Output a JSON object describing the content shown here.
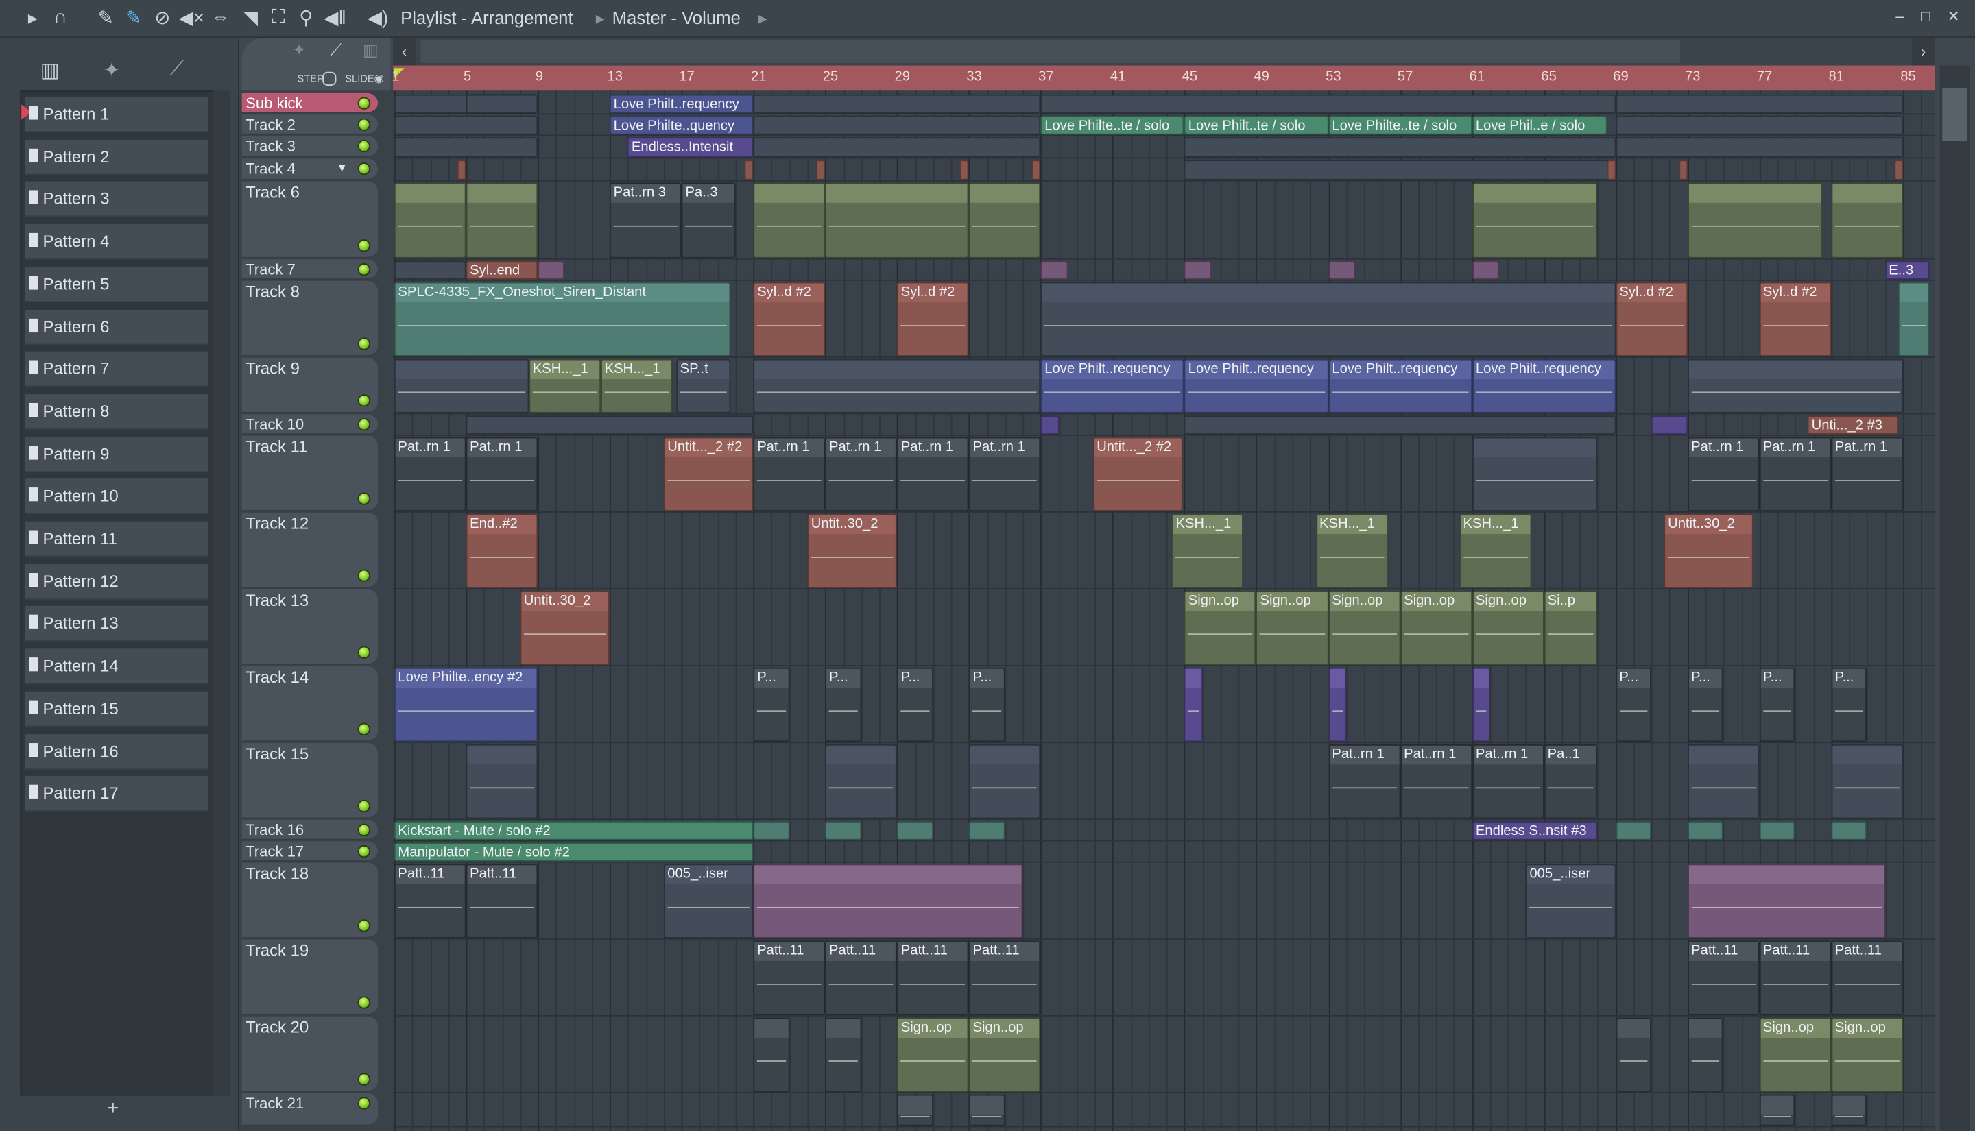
{
  "toolbar": {
    "breadcrumb": [
      "Playlist - Arrangement",
      "Master - Volume"
    ],
    "icons": [
      "play-arrow-icon",
      "magnet-icon",
      "pencil-icon",
      "paint-icon",
      "delete-icon",
      "mute-icon",
      "slip-icon",
      "select-icon",
      "zoom-select-icon",
      "zoom-icon",
      "playback-icon",
      "speaker-icon"
    ]
  },
  "picker": {
    "tabs": [
      "piano-roll-icon",
      "audio-icon",
      "automation-icon"
    ],
    "patterns": [
      "Pattern 1",
      "Pattern 2",
      "Pattern 3",
      "Pattern 4",
      "Pattern 5",
      "Pattern 6",
      "Pattern 7",
      "Pattern 8",
      "Pattern 9",
      "Pattern 10",
      "Pattern 11",
      "Pattern 12",
      "Pattern 13",
      "Pattern 14",
      "Pattern 15",
      "Pattern 16",
      "Pattern 17"
    ],
    "add": "+"
  },
  "snap": {
    "step": "STEP",
    "slide": "SLIDE"
  },
  "ruler": [
    "1",
    "5",
    "9",
    "13",
    "17",
    "21",
    "25",
    "29",
    "33",
    "37",
    "41",
    "45",
    "49",
    "53",
    "57",
    "61",
    "65",
    "69",
    "73",
    "77",
    "81",
    "85"
  ],
  "colors": {
    "accent": "#b85a72",
    "ruler": "#a2585c",
    "led": "#7bc523"
  },
  "tracks": [
    {
      "name": "Sub kick",
      "clips": [
        {
          "s": 1,
          "l": 8,
          "c": "dark"
        },
        {
          "s": 5,
          "l": 4,
          "c": "dark"
        },
        {
          "s": 13,
          "l": 8,
          "c": "auto",
          "t": "Love Philt..requency"
        },
        {
          "s": 21,
          "l": 16,
          "c": "dark"
        },
        {
          "s": 37,
          "l": 32,
          "c": "dark"
        },
        {
          "s": 69,
          "l": 16,
          "c": "dark"
        }
      ]
    },
    {
      "name": "Track 2",
      "clips": [
        {
          "s": 1,
          "l": 8,
          "c": "dark"
        },
        {
          "s": 13,
          "l": 8,
          "c": "auto",
          "t": "Love Philte..quency"
        },
        {
          "s": 21,
          "l": 16,
          "c": "dark"
        },
        {
          "s": 37,
          "l": 8,
          "c": "green",
          "t": "Love Philte..te / solo"
        },
        {
          "s": 45,
          "l": 8,
          "c": "green",
          "t": "Love Philt..te / solo"
        },
        {
          "s": 53,
          "l": 8,
          "c": "green",
          "t": "Love Philte..te / solo"
        },
        {
          "s": 61,
          "l": 7.5,
          "c": "green",
          "t": "Love Phil..e / solo"
        },
        {
          "s": 69,
          "l": 16,
          "c": "dark"
        }
      ]
    },
    {
      "name": "Track 3",
      "clips": [
        {
          "s": 1,
          "l": 8,
          "c": "dark"
        },
        {
          "s": 14,
          "l": 7,
          "c": "auto2",
          "t": "Endless..Intensit"
        },
        {
          "s": 21,
          "l": 16,
          "c": "dark"
        },
        {
          "s": 45,
          "l": 24,
          "c": "dark"
        },
        {
          "s": 69,
          "l": 16,
          "c": "dark"
        }
      ]
    },
    {
      "name": "Track 4",
      "clips": [
        {
          "s": 4.5,
          "l": 0.5,
          "c": "brown"
        },
        {
          "s": 20.5,
          "l": 0.5,
          "c": "brown"
        },
        {
          "s": 24.5,
          "l": 0.5,
          "c": "brown"
        },
        {
          "s": 32.5,
          "l": 0.5,
          "c": "brown"
        },
        {
          "s": 36.5,
          "l": 0.5,
          "c": "brown"
        },
        {
          "s": 45,
          "l": 24,
          "c": "dark"
        },
        {
          "s": 68.5,
          "l": 0.5,
          "c": "brown"
        },
        {
          "s": 72.5,
          "l": 0.5,
          "c": "brown"
        },
        {
          "s": 84.5,
          "l": 0.5,
          "c": "brown"
        }
      ]
    },
    {
      "name": "Track 6",
      "clips": [
        {
          "s": 1,
          "l": 4,
          "c": "olive"
        },
        {
          "s": 5,
          "l": 4,
          "c": "olive"
        },
        {
          "s": 13,
          "l": 4,
          "c": "pat",
          "t": "Pat..rn 3"
        },
        {
          "s": 17,
          "l": 3,
          "c": "pat",
          "t": "Pa..3"
        },
        {
          "s": 21,
          "l": 4,
          "c": "olive"
        },
        {
          "s": 25,
          "l": 8,
          "c": "olive"
        },
        {
          "s": 33,
          "l": 4,
          "c": "olive"
        },
        {
          "s": 61,
          "l": 7,
          "c": "olive"
        },
        {
          "s": 73,
          "l": 7.5,
          "c": "olive"
        },
        {
          "s": 81,
          "l": 4,
          "c": "olive"
        }
      ]
    },
    {
      "name": "Track 7",
      "clips": [
        {
          "s": 1,
          "l": 4,
          "c": "dark"
        },
        {
          "s": 5,
          "l": 4,
          "c": "brown",
          "t": "Syl..end"
        },
        {
          "s": 9,
          "l": 1.5,
          "c": "pink"
        },
        {
          "s": 37,
          "l": 1.5,
          "c": "pink"
        },
        {
          "s": 45,
          "l": 1.5,
          "c": "pink"
        },
        {
          "s": 53,
          "l": 1.5,
          "c": "pink"
        },
        {
          "s": 61,
          "l": 1.5,
          "c": "pink"
        },
        {
          "s": 84,
          "l": 2.5,
          "c": "auto2",
          "t": "E..3"
        }
      ]
    },
    {
      "name": "Track 8",
      "clips": [
        {
          "s": 1,
          "l": 18.7,
          "c": "teal",
          "t": "SPLC-4335_FX_Oneshot_Siren_Distant"
        },
        {
          "s": 21,
          "l": 4,
          "c": "brown",
          "t": "Syl..d #2"
        },
        {
          "s": 29,
          "l": 4,
          "c": "brown",
          "t": "Syl..d #2"
        },
        {
          "s": 37,
          "l": 32,
          "c": "dark"
        },
        {
          "s": 69,
          "l": 4,
          "c": "brown",
          "t": "Syl..d #2"
        },
        {
          "s": 77,
          "l": 4,
          "c": "brown",
          "t": "Syl..d #2"
        },
        {
          "s": 84.7,
          "l": 1.8,
          "c": "teal"
        }
      ]
    },
    {
      "name": "Track 9",
      "clips": [
        {
          "s": 1,
          "l": 7.5,
          "c": "dark"
        },
        {
          "s": 8.5,
          "l": 4,
          "c": "olive",
          "t": "KSH..._1"
        },
        {
          "s": 12.5,
          "l": 4,
          "c": "olive",
          "t": "KSH..._1"
        },
        {
          "s": 16.7,
          "l": 3,
          "c": "dark",
          "t": "SP..t"
        },
        {
          "s": 21,
          "l": 16,
          "c": "dark"
        },
        {
          "s": 37,
          "l": 8,
          "c": "auto",
          "t": "Love Philt..requency"
        },
        {
          "s": 45,
          "l": 8,
          "c": "auto",
          "t": "Love Philt..requency"
        },
        {
          "s": 53,
          "l": 8,
          "c": "auto",
          "t": "Love Philt..requency"
        },
        {
          "s": 61,
          "l": 8,
          "c": "auto",
          "t": "Love Philt..requency"
        },
        {
          "s": 73,
          "l": 12,
          "c": "dark"
        }
      ]
    },
    {
      "name": "Track 10",
      "clips": [
        {
          "s": 5,
          "l": 16,
          "c": "dark"
        },
        {
          "s": 37,
          "l": 1,
          "c": "auto2"
        },
        {
          "s": 45,
          "l": 24,
          "c": "dark"
        },
        {
          "s": 71,
          "l": 2,
          "c": "auto2"
        },
        {
          "s": 79.7,
          "l": 5,
          "c": "brown",
          "t": "Unti..._2 #3"
        }
      ]
    },
    {
      "name": "Track 11",
      "clips": [
        {
          "s": 1,
          "l": 4,
          "c": "pat",
          "t": "Pat..rn 1"
        },
        {
          "s": 5,
          "l": 4,
          "c": "pat",
          "t": "Pat..rn 1"
        },
        {
          "s": 16,
          "l": 5,
          "c": "brown",
          "t": "Untit..._2 #2"
        },
        {
          "s": 21,
          "l": 4,
          "c": "pat",
          "t": "Pat..rn 1"
        },
        {
          "s": 25,
          "l": 4,
          "c": "pat",
          "t": "Pat..rn 1"
        },
        {
          "s": 29,
          "l": 4,
          "c": "pat",
          "t": "Pat..rn 1"
        },
        {
          "s": 33,
          "l": 4,
          "c": "pat",
          "t": "Pat..rn 1"
        },
        {
          "s": 39.9,
          "l": 5,
          "c": "brown",
          "t": "Untit..._2 #2"
        },
        {
          "s": 61,
          "l": 7,
          "c": "dark"
        },
        {
          "s": 73,
          "l": 4,
          "c": "pat",
          "t": "Pat..rn 1"
        },
        {
          "s": 77,
          "l": 4,
          "c": "pat",
          "t": "Pat..rn 1"
        },
        {
          "s": 81,
          "l": 4,
          "c": "pat",
          "t": "Pat..rn 1"
        }
      ]
    },
    {
      "name": "Track 12",
      "clips": [
        {
          "s": 5,
          "l": 4,
          "c": "brown",
          "t": "End..#2"
        },
        {
          "s": 24,
          "l": 5,
          "c": "brown",
          "t": "Untit..30_2"
        },
        {
          "s": 44.3,
          "l": 4,
          "c": "olive",
          "t": "KSH..._1"
        },
        {
          "s": 52.3,
          "l": 4,
          "c": "olive",
          "t": "KSH..._1"
        },
        {
          "s": 60.3,
          "l": 4,
          "c": "olive",
          "t": "KSH..._1"
        },
        {
          "s": 71.7,
          "l": 5,
          "c": "brown",
          "t": "Untit..30_2"
        }
      ]
    },
    {
      "name": "Track 13",
      "clips": [
        {
          "s": 8,
          "l": 5,
          "c": "brown",
          "t": "Untit..30_2"
        },
        {
          "s": 45,
          "l": 4,
          "c": "olive",
          "t": "Sign..op"
        },
        {
          "s": 49,
          "l": 4,
          "c": "olive",
          "t": "Sign..op"
        },
        {
          "s": 53,
          "l": 4,
          "c": "olive",
          "t": "Sign..op"
        },
        {
          "s": 57,
          "l": 4,
          "c": "olive",
          "t": "Sign..op"
        },
        {
          "s": 61,
          "l": 4,
          "c": "olive",
          "t": "Sign..op"
        },
        {
          "s": 65,
          "l": 3,
          "c": "olive",
          "t": "Si..p"
        }
      ]
    },
    {
      "name": "Track 14",
      "clips": [
        {
          "s": 1,
          "l": 8,
          "c": "auto",
          "t": "Love Philte..ency #2"
        },
        {
          "s": 21,
          "l": 2,
          "c": "pat",
          "t": "P..."
        },
        {
          "s": 25,
          "l": 2,
          "c": "pat",
          "t": "P..."
        },
        {
          "s": 29,
          "l": 2,
          "c": "pat",
          "t": "P..."
        },
        {
          "s": 33,
          "l": 2,
          "c": "pat",
          "t": "P..."
        },
        {
          "s": 45,
          "l": 1,
          "c": "auto2"
        },
        {
          "s": 53,
          "l": 1,
          "c": "auto2"
        },
        {
          "s": 61,
          "l": 1,
          "c": "auto2"
        },
        {
          "s": 69,
          "l": 2,
          "c": "pat",
          "t": "P..."
        },
        {
          "s": 73,
          "l": 2,
          "c": "pat",
          "t": "P..."
        },
        {
          "s": 77,
          "l": 2,
          "c": "pat",
          "t": "P..."
        },
        {
          "s": 81,
          "l": 2,
          "c": "pat",
          "t": "P..."
        }
      ]
    },
    {
      "name": "Track 15",
      "clips": [
        {
          "s": 5,
          "l": 4,
          "c": "dark"
        },
        {
          "s": 25,
          "l": 4,
          "c": "dark"
        },
        {
          "s": 33,
          "l": 4,
          "c": "dark"
        },
        {
          "s": 53,
          "l": 4,
          "c": "pat",
          "t": "Pat..rn 1"
        },
        {
          "s": 57,
          "l": 4,
          "c": "pat",
          "t": "Pat..rn 1"
        },
        {
          "s": 61,
          "l": 4,
          "c": "pat",
          "t": "Pat..rn 1"
        },
        {
          "s": 65,
          "l": 3,
          "c": "pat",
          "t": "Pa..1"
        },
        {
          "s": 73,
          "l": 4,
          "c": "dark"
        },
        {
          "s": 81,
          "l": 4,
          "c": "dark"
        }
      ]
    },
    {
      "name": "Track 16",
      "clips": [
        {
          "s": 1,
          "l": 20,
          "c": "green",
          "t": "Kickstart - Mute / solo #2"
        },
        {
          "s": 21,
          "l": 2,
          "c": "teal"
        },
        {
          "s": 25,
          "l": 2,
          "c": "teal"
        },
        {
          "s": 29,
          "l": 2,
          "c": "teal"
        },
        {
          "s": 33,
          "l": 2,
          "c": "teal"
        },
        {
          "s": 61,
          "l": 7,
          "c": "auto2",
          "t": "Endless S..nsit #3"
        },
        {
          "s": 69,
          "l": 2,
          "c": "teal"
        },
        {
          "s": 73,
          "l": 2,
          "c": "teal"
        },
        {
          "s": 77,
          "l": 2,
          "c": "teal"
        },
        {
          "s": 81,
          "l": 2,
          "c": "teal"
        }
      ]
    },
    {
      "name": "Track 17",
      "clips": [
        {
          "s": 1,
          "l": 20,
          "c": "green",
          "t": "Manipulator - Mute / solo #2"
        }
      ]
    },
    {
      "name": "Track 18",
      "clips": [
        {
          "s": 1,
          "l": 4,
          "c": "pat",
          "t": "Patt..11"
        },
        {
          "s": 5,
          "l": 4,
          "c": "pat",
          "t": "Patt..11"
        },
        {
          "s": 16,
          "l": 5,
          "c": "dark",
          "t": "005_..iser"
        },
        {
          "s": 21,
          "l": 15,
          "c": "pink"
        },
        {
          "s": 64,
          "l": 5,
          "c": "dark",
          "t": "005_..iser"
        },
        {
          "s": 73,
          "l": 11,
          "c": "pink"
        }
      ]
    },
    {
      "name": "Track 19",
      "clips": [
        {
          "s": 21,
          "l": 4,
          "c": "pat",
          "t": "Patt..11"
        },
        {
          "s": 25,
          "l": 4,
          "c": "pat",
          "t": "Patt..11"
        },
        {
          "s": 29,
          "l": 4,
          "c": "pat",
          "t": "Patt..11"
        },
        {
          "s": 33,
          "l": 4,
          "c": "pat",
          "t": "Patt..11"
        },
        {
          "s": 73,
          "l": 4,
          "c": "pat",
          "t": "Patt..11"
        },
        {
          "s": 77,
          "l": 4,
          "c": "pat",
          "t": "Patt..11"
        },
        {
          "s": 81,
          "l": 4,
          "c": "pat",
          "t": "Patt..11"
        }
      ]
    },
    {
      "name": "Track 20",
      "clips": [
        {
          "s": 21,
          "l": 2,
          "c": "pat"
        },
        {
          "s": 25,
          "l": 2,
          "c": "pat"
        },
        {
          "s": 29,
          "l": 4,
          "c": "olive",
          "t": "Sign..op"
        },
        {
          "s": 33,
          "l": 4,
          "c": "olive",
          "t": "Sign..op"
        },
        {
          "s": 69,
          "l": 2,
          "c": "pat"
        },
        {
          "s": 73,
          "l": 2,
          "c": "pat"
        },
        {
          "s": 77,
          "l": 4,
          "c": "olive",
          "t": "Sign..op"
        },
        {
          "s": 81,
          "l": 4,
          "c": "olive",
          "t": "Sign..op"
        }
      ]
    },
    {
      "name": "Track 21",
      "clips": [
        {
          "s": 29,
          "l": 2,
          "c": "pat"
        },
        {
          "s": 33,
          "l": 2,
          "c": "pat"
        },
        {
          "s": 77,
          "l": 2,
          "c": "pat"
        },
        {
          "s": 81,
          "l": 2,
          "c": "pat"
        }
      ]
    }
  ]
}
